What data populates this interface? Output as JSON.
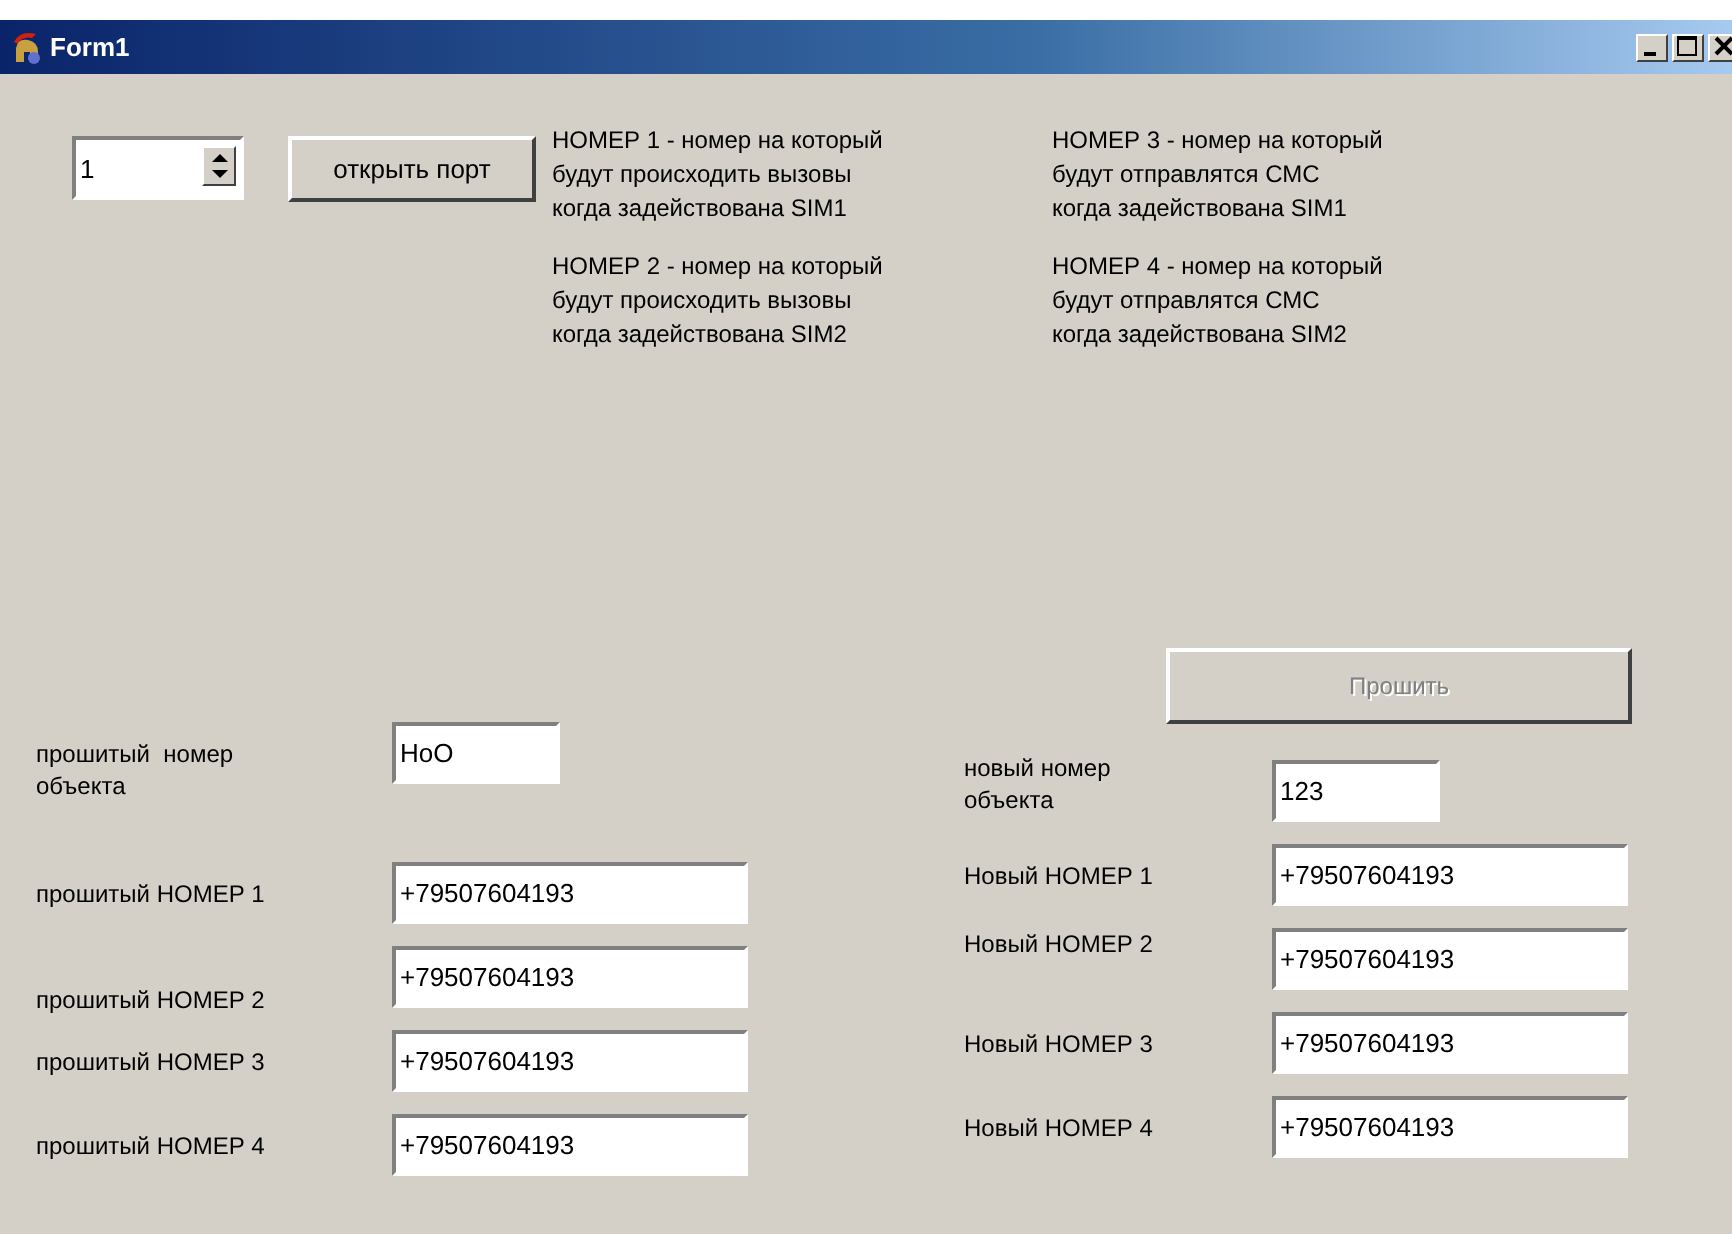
{
  "window": {
    "title": "Form1"
  },
  "port": {
    "value": "1"
  },
  "open_port_button": {
    "label": "открыть порт"
  },
  "notes": [
    "НОМЕР 1 - номер на который\nбудут происходить вызовы\nкогда задействована SIM1",
    "НОМЕР 3 - номер на который\nбудут отправлятся СМС\nкогда задействована SIM1",
    "НОМЕР 2 - номер на который\nбудут происходить вызовы\nкогда задействована SIM2",
    "НОМЕР 4 - номер на который\nбудут отправлятся СМС\nкогда задействована SIM2"
  ],
  "flash_button": {
    "label": "Прошить",
    "disabled": true
  },
  "current": {
    "object_label": "прошитый  номер\nобъекта",
    "object_value": "HoO",
    "numbers": [
      {
        "label": "прошитый НОМЕР 1",
        "value": "+79507604193"
      },
      {
        "label": "прошитый НОМЕР 2",
        "value": "+79507604193"
      },
      {
        "label": "прошитый НОМЕР 3",
        "value": "+79507604193"
      },
      {
        "label": "прошитый НОМЕР 4",
        "value": "+79507604193"
      }
    ]
  },
  "new": {
    "object_label": "новый номер\nобъекта",
    "object_value": "123",
    "numbers": [
      {
        "label": "Новый НОМЕР 1",
        "value": "+79507604193"
      },
      {
        "label": "Новый НОМЕР 2",
        "value": "+79507604193"
      },
      {
        "label": "Новый НОМЕР 3",
        "value": "+79507604193"
      },
      {
        "label": "Новый НОМЕР 4",
        "value": "+79507604193"
      }
    ]
  }
}
